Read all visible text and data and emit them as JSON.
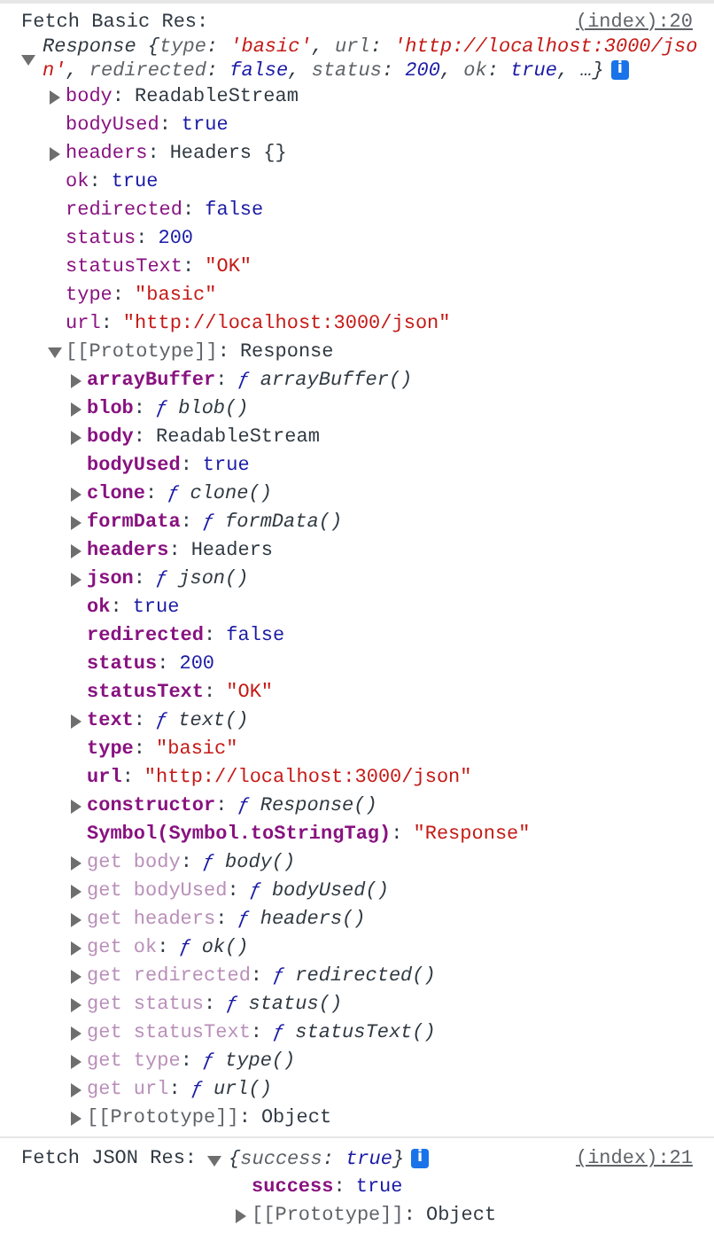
{
  "separator": ":",
  "messages": [
    {
      "kind": "block",
      "label": "Fetch Basic Res:",
      "source": "(index):20",
      "object": {
        "expanded": true,
        "badge": "i",
        "summary": [
          {
            "text": "Response {",
            "kind": "plain"
          },
          {
            "text": "type",
            "kind": "key"
          },
          {
            "text": ": ",
            "kind": "plain"
          },
          {
            "text": "'basic'",
            "kind": "string"
          },
          {
            "text": ", ",
            "kind": "plain"
          },
          {
            "text": "url",
            "kind": "key"
          },
          {
            "text": ": ",
            "kind": "plain"
          },
          {
            "text": "'http://localhost:3000/json'",
            "kind": "string"
          },
          {
            "text": ", ",
            "kind": "plain"
          },
          {
            "text": "redirected",
            "kind": "key"
          },
          {
            "text": ": ",
            "kind": "plain"
          },
          {
            "text": "false",
            "kind": "boolean"
          },
          {
            "text": ", ",
            "kind": "plain"
          },
          {
            "text": "status",
            "kind": "key"
          },
          {
            "text": ": ",
            "kind": "plain"
          },
          {
            "text": "200",
            "kind": "number"
          },
          {
            "text": ", ",
            "kind": "plain"
          },
          {
            "text": "ok",
            "kind": "key"
          },
          {
            "text": ": ",
            "kind": "plain"
          },
          {
            "text": "true",
            "kind": "boolean"
          },
          {
            "text": ", …}",
            "kind": "plain"
          }
        ],
        "properties": [
          {
            "key": "body",
            "kind": "own",
            "value": {
              "kind": "object",
              "text": "ReadableStream"
            },
            "expanded": false
          },
          {
            "key": "bodyUsed",
            "kind": "own",
            "value": {
              "kind": "boolean",
              "text": "true"
            }
          },
          {
            "key": "headers",
            "kind": "own",
            "value": {
              "kind": "object",
              "text": "Headers {}"
            },
            "expanded": false
          },
          {
            "key": "ok",
            "kind": "own",
            "value": {
              "kind": "boolean",
              "text": "true"
            }
          },
          {
            "key": "redirected",
            "kind": "own",
            "value": {
              "kind": "boolean",
              "text": "false"
            }
          },
          {
            "key": "status",
            "kind": "own",
            "value": {
              "kind": "number",
              "text": "200"
            }
          },
          {
            "key": "statusText",
            "kind": "own",
            "value": {
              "kind": "string",
              "text": "\"OK\""
            }
          },
          {
            "key": "type",
            "kind": "own",
            "value": {
              "kind": "string",
              "text": "\"basic\""
            }
          },
          {
            "key": "url",
            "kind": "own",
            "value": {
              "kind": "string",
              "text": "\"http://localhost:3000/json\""
            }
          },
          {
            "key": "[[Prototype]]",
            "kind": "internal",
            "value": {
              "kind": "object",
              "text": "Response"
            },
            "expanded": true,
            "children": [
              {
                "key": "arrayBuffer",
                "kind": "inherited",
                "value": {
                  "kind": "function",
                  "marker": "ƒ",
                  "text": "arrayBuffer()"
                },
                "expanded": false
              },
              {
                "key": "blob",
                "kind": "inherited",
                "value": {
                  "kind": "function",
                  "marker": "ƒ",
                  "text": "blob()"
                },
                "expanded": false
              },
              {
                "key": "body",
                "kind": "inherited",
                "value": {
                  "kind": "object",
                  "text": "ReadableStream"
                },
                "expanded": false
              },
              {
                "key": "bodyUsed",
                "kind": "inherited",
                "value": {
                  "kind": "boolean",
                  "text": "true"
                }
              },
              {
                "key": "clone",
                "kind": "inherited",
                "value": {
                  "kind": "function",
                  "marker": "ƒ",
                  "text": "clone()"
                },
                "expanded": false
              },
              {
                "key": "formData",
                "kind": "inherited",
                "value": {
                  "kind": "function",
                  "marker": "ƒ",
                  "text": "formData()"
                },
                "expanded": false
              },
              {
                "key": "headers",
                "kind": "inherited",
                "value": {
                  "kind": "object",
                  "text": "Headers"
                },
                "expanded": false
              },
              {
                "key": "json",
                "kind": "inherited",
                "value": {
                  "kind": "function",
                  "marker": "ƒ",
                  "text": "json()"
                },
                "expanded": false
              },
              {
                "key": "ok",
                "kind": "inherited",
                "value": {
                  "kind": "boolean",
                  "text": "true"
                }
              },
              {
                "key": "redirected",
                "kind": "inherited",
                "value": {
                  "kind": "boolean",
                  "text": "false"
                }
              },
              {
                "key": "status",
                "kind": "inherited",
                "value": {
                  "kind": "number",
                  "text": "200"
                }
              },
              {
                "key": "statusText",
                "kind": "inherited",
                "value": {
                  "kind": "string",
                  "text": "\"OK\""
                }
              },
              {
                "key": "text",
                "kind": "inherited",
                "value": {
                  "kind": "function",
                  "marker": "ƒ",
                  "text": "text()"
                },
                "expanded": false
              },
              {
                "key": "type",
                "kind": "inherited",
                "value": {
                  "kind": "string",
                  "text": "\"basic\""
                }
              },
              {
                "key": "url",
                "kind": "inherited",
                "value": {
                  "kind": "string",
                  "text": "\"http://localhost:3000/json\""
                }
              },
              {
                "key": "constructor",
                "kind": "inherited",
                "value": {
                  "kind": "function",
                  "marker": "ƒ",
                  "text": "Response()"
                },
                "expanded": false
              },
              {
                "key": "Symbol(Symbol.toStringTag)",
                "kind": "inherited",
                "value": {
                  "kind": "string",
                  "text": "\"Response\""
                }
              },
              {
                "key": "get body",
                "kind": "accessor",
                "value": {
                  "kind": "function",
                  "marker": "ƒ",
                  "text": "body()"
                },
                "expanded": false
              },
              {
                "key": "get bodyUsed",
                "kind": "accessor",
                "value": {
                  "kind": "function",
                  "marker": "ƒ",
                  "text": "bodyUsed()"
                },
                "expanded": false
              },
              {
                "key": "get headers",
                "kind": "accessor",
                "value": {
                  "kind": "function",
                  "marker": "ƒ",
                  "text": "headers()"
                },
                "expanded": false
              },
              {
                "key": "get ok",
                "kind": "accessor",
                "value": {
                  "kind": "function",
                  "marker": "ƒ",
                  "text": "ok()"
                },
                "expanded": false
              },
              {
                "key": "get redirected",
                "kind": "accessor",
                "value": {
                  "kind": "function",
                  "marker": "ƒ",
                  "text": "redirected()"
                },
                "expanded": false
              },
              {
                "key": "get status",
                "kind": "accessor",
                "value": {
                  "kind": "function",
                  "marker": "ƒ",
                  "text": "status()"
                },
                "expanded": false
              },
              {
                "key": "get statusText",
                "kind": "accessor",
                "value": {
                  "kind": "function",
                  "marker": "ƒ",
                  "text": "statusText()"
                },
                "expanded": false
              },
              {
                "key": "get type",
                "kind": "accessor",
                "value": {
                  "kind": "function",
                  "marker": "ƒ",
                  "text": "type()"
                },
                "expanded": false
              },
              {
                "key": "get url",
                "kind": "accessor",
                "value": {
                  "kind": "function",
                  "marker": "ƒ",
                  "text": "url()"
                },
                "expanded": false
              },
              {
                "key": "[[Prototype]]",
                "kind": "internal",
                "value": {
                  "kind": "object",
                  "text": "Object"
                },
                "expanded": false
              }
            ]
          }
        ]
      }
    },
    {
      "kind": "inline",
      "label": "Fetch JSON Res:",
      "source": "(index):21",
      "object": {
        "expanded": true,
        "badge": "i",
        "summary": [
          {
            "text": "{",
            "kind": "plain"
          },
          {
            "text": "success",
            "kind": "key"
          },
          {
            "text": ": ",
            "kind": "plain"
          },
          {
            "text": "true",
            "kind": "boolean"
          },
          {
            "text": "}",
            "kind": "plain"
          }
        ],
        "properties": [
          {
            "key": "success",
            "kind": "inherited",
            "value": {
              "kind": "boolean",
              "text": "true"
            }
          },
          {
            "key": "[[Prototype]]",
            "kind": "internal",
            "value": {
              "kind": "object",
              "text": "Object"
            },
            "expanded": false
          }
        ]
      }
    }
  ]
}
